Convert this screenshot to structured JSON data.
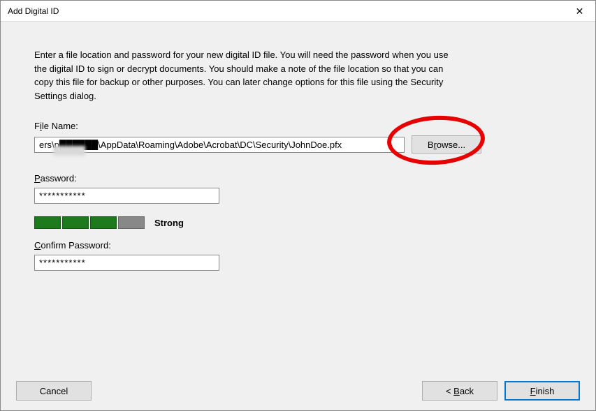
{
  "title": "Add Digital ID",
  "instructions": "Enter a file location and password for your new digital ID file. You will need the password when you use the digital ID to sign or decrypt documents. You should make a note of the file location so that you can copy this file for backup or other purposes. You can later change options for this file using the Security Settings dialog.",
  "labels": {
    "fileName_pre": "F",
    "fileName_u": "i",
    "fileName_post": "le Name:",
    "password_u": "P",
    "password_post": "assword:",
    "confirm_u": "C",
    "confirm_post": "onfirm Password:",
    "browse_pre": "B",
    "browse_u": "r",
    "browse_post": "owse...",
    "cancel": "Cancel",
    "back_pre": "< ",
    "back_u": "B",
    "back_post": "ack",
    "finish_u": "F",
    "finish_post": "inish"
  },
  "values": {
    "filename": "ers\\p██████\\AppData\\Roaming\\Adobe\\Acrobat\\DC\\Security\\JohnDoe.pfx",
    "password": "***********",
    "confirm": "***********"
  },
  "strength": {
    "label": "Strong",
    "filled": 3,
    "total": 4
  }
}
